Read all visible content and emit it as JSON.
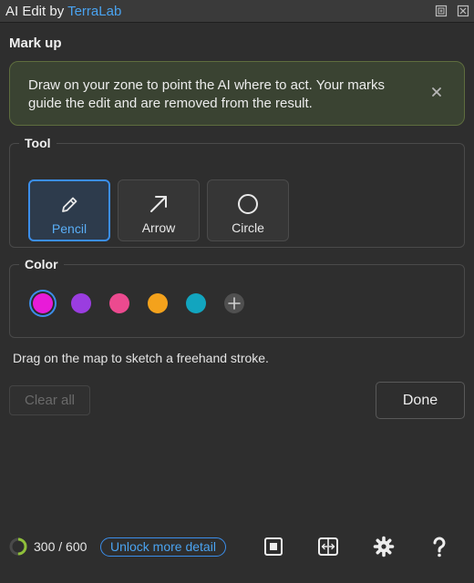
{
  "window": {
    "title_prefix": "AI Edit by ",
    "title_brand": "TerraLab"
  },
  "heading": "Mark up",
  "notice": {
    "text": "Draw on your zone to point the AI where to act. Your marks guide the edit and are removed from the result."
  },
  "tool_group": {
    "legend": "Tool",
    "tools": [
      {
        "label": "Pencil",
        "icon": "pencil-icon",
        "selected": true
      },
      {
        "label": "Arrow",
        "icon": "arrow-icon",
        "selected": false
      },
      {
        "label": "Circle",
        "icon": "circle-icon",
        "selected": false
      }
    ]
  },
  "color_group": {
    "legend": "Color",
    "swatches": [
      {
        "name": "magenta",
        "hex": "#e81bd8",
        "selected": true
      },
      {
        "name": "purple",
        "hex": "#9a3de0",
        "selected": false
      },
      {
        "name": "pink",
        "hex": "#ec4a8f",
        "selected": false
      },
      {
        "name": "orange",
        "hex": "#f4a21c",
        "selected": false
      },
      {
        "name": "teal",
        "hex": "#12a5bf",
        "selected": false
      }
    ]
  },
  "hint": "Drag on the map to sketch a freehand stroke.",
  "buttons": {
    "clear": "Clear all",
    "done": "Done"
  },
  "footer": {
    "quota_used": 300,
    "quota_total": 600,
    "quota_text": "300 / 600",
    "unlock": "Unlock more detail"
  },
  "colors": {
    "accent": "#3b8eea",
    "link": "#4aa3f0",
    "progress": "#8fbf3a"
  }
}
